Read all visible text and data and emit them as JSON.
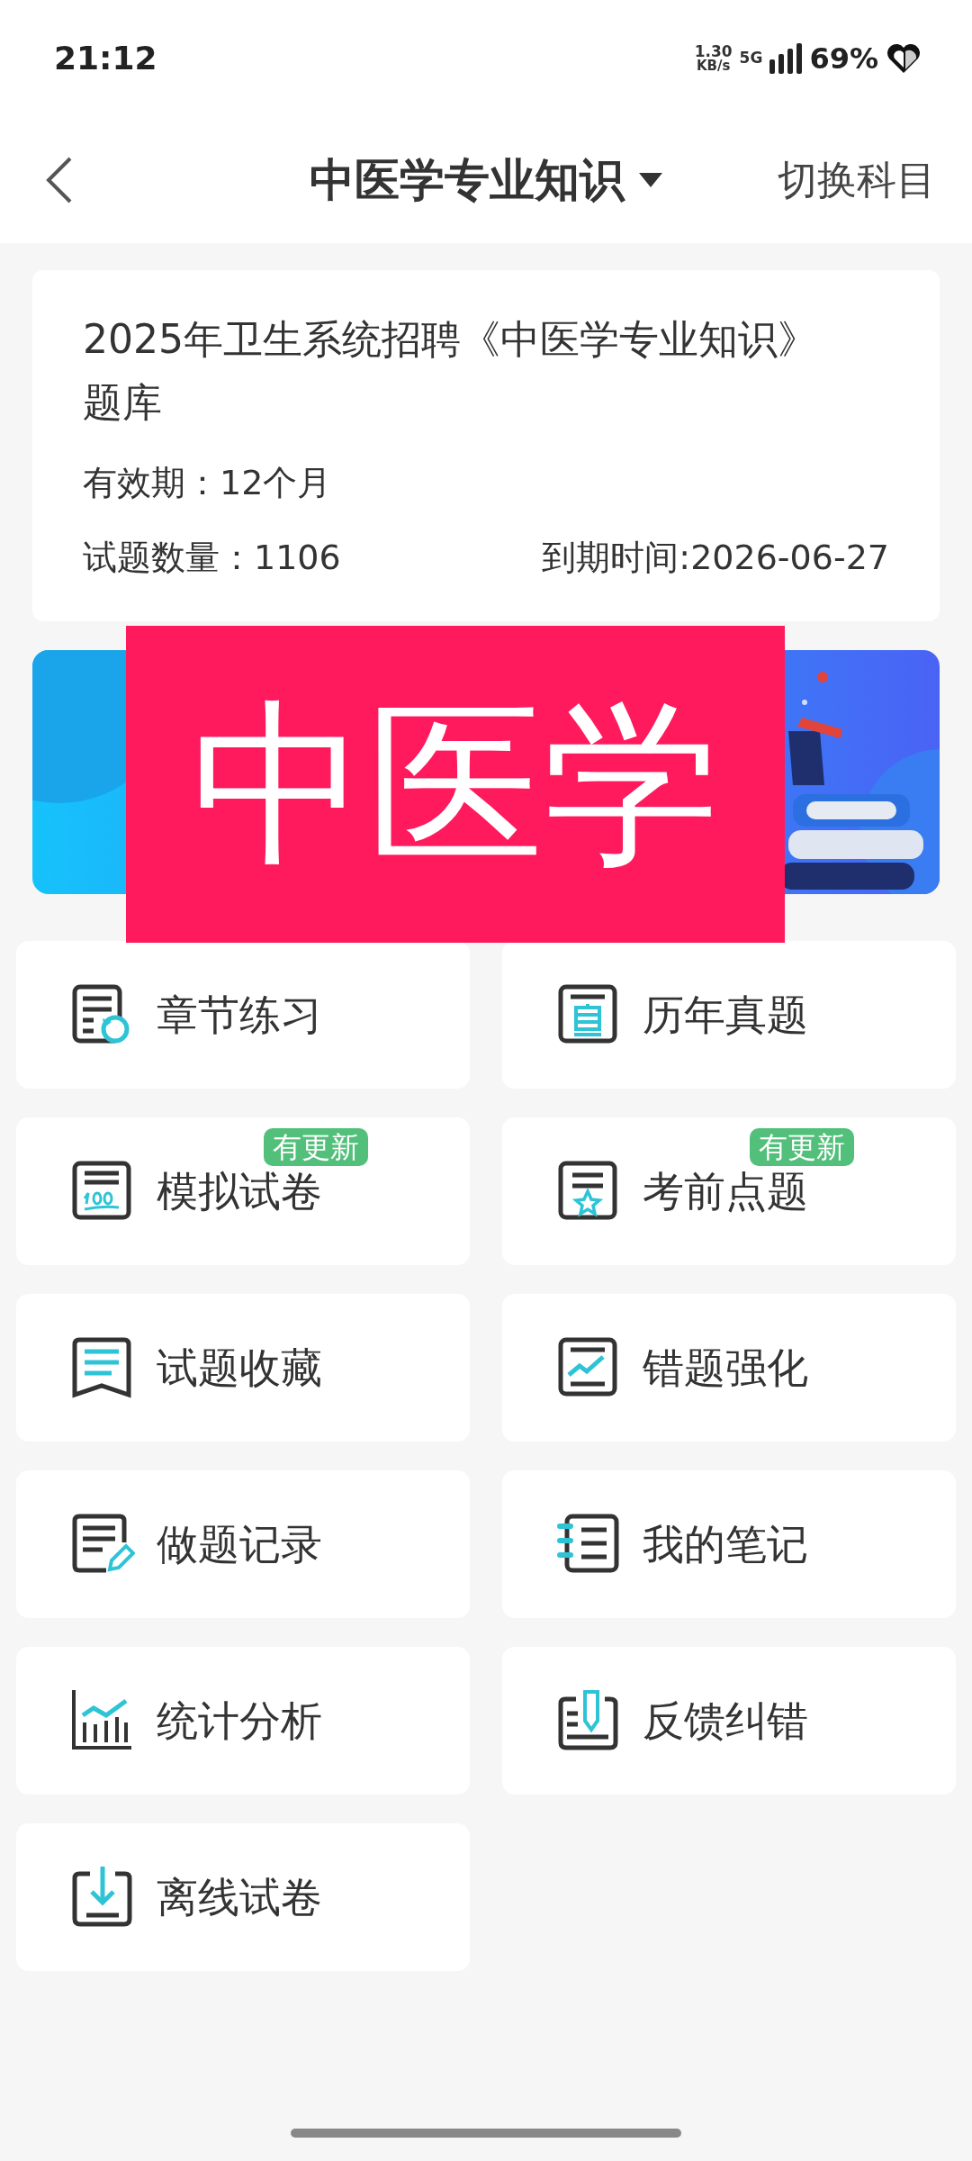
{
  "status_bar": {
    "time": "21:12",
    "net_speed": "1.30",
    "net_unit": "KB/s",
    "network": "5G",
    "battery": "69%"
  },
  "header": {
    "title": "中医学专业知识",
    "action": "切换科目"
  },
  "info_card": {
    "title": "2025年卫生系统招聘《中医学专业知识》题库",
    "validity": "有效期：12个月",
    "count": "试题数量：1106",
    "expiry": "到期时间:2026-06-27"
  },
  "overlay": {
    "text": "中医学"
  },
  "menu": [
    {
      "kind": "chapter",
      "label": "章节练习"
    },
    {
      "kind": "past",
      "label": "历年真题"
    },
    {
      "kind": "mock",
      "label": "模拟试卷",
      "badge": "有更新"
    },
    {
      "kind": "star",
      "label": "考前点题",
      "badge": "有更新"
    },
    {
      "kind": "bookmark",
      "label": "试题收藏"
    },
    {
      "kind": "trend",
      "label": "错题强化"
    },
    {
      "kind": "record",
      "label": "做题记录"
    },
    {
      "kind": "notebook",
      "label": "我的笔记"
    },
    {
      "kind": "stats",
      "label": "统计分析"
    },
    {
      "kind": "feedback",
      "label": "反馈纠错"
    },
    {
      "kind": "download",
      "label": "离线试卷"
    }
  ]
}
